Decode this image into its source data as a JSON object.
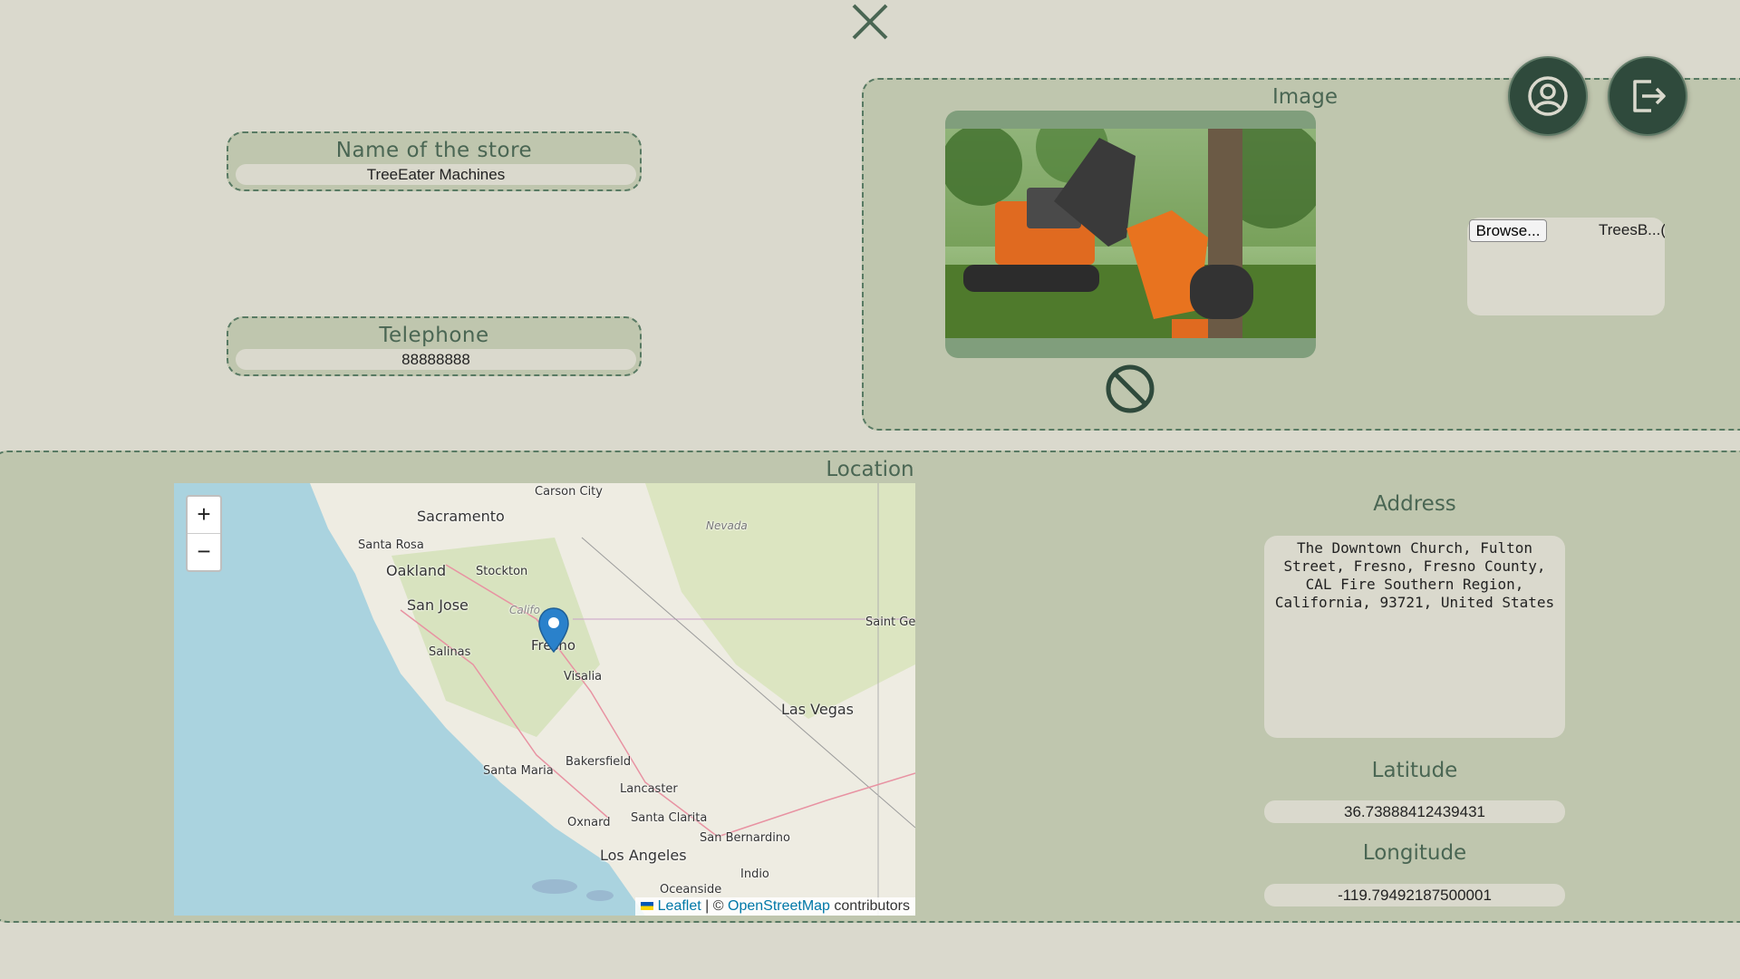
{
  "store": {
    "label": "Name of the store",
    "value": "TreeEater Machines"
  },
  "telephone": {
    "label": "Telephone",
    "value": "88888888"
  },
  "image": {
    "title": "Image",
    "browse_label": "Browse...",
    "file_name": "TreesB...(",
    "remove_icon": "no-entry-icon"
  },
  "header": {
    "close_icon": "close-icon",
    "profile_icon": "user-circle-icon",
    "logout_icon": "logout-icon"
  },
  "location": {
    "title": "Location",
    "zoom_in": "+",
    "zoom_out": "−",
    "attribution_leaflet": "Leaflet",
    "attribution_sep": "| ©",
    "attribution_osm": "OpenStreetMap",
    "attribution_tail": "contributors",
    "places": [
      "Carson City",
      "Sacramento",
      "Nevada",
      "Santa Rosa",
      "Oakland",
      "Stockton",
      "San Jose",
      "Califo",
      "Fresno",
      "Saint Ge",
      "Salinas",
      "Visalia",
      "Las Vegas",
      "Santa Maria",
      "Bakersfield",
      "Lancaster",
      "Santa Clarita",
      "Oxnard",
      "San Bernardino",
      "Los Angeles",
      "Indio",
      "Oceanside"
    ]
  },
  "address": {
    "label": "Address",
    "value": "The Downtown Church, Fulton Street, Fresno, Fresno County, CAL Fire Southern Region, California, 93721, United States"
  },
  "latitude": {
    "label": "Latitude",
    "value": "36.73888412439431"
  },
  "longitude": {
    "label": "Longitude",
    "value": "-119.79492187500001"
  },
  "colors": {
    "background": "#dad9cd",
    "panel": "#bfc6ae",
    "accent_dark": "#2f4a3c",
    "border": "#587a63"
  }
}
